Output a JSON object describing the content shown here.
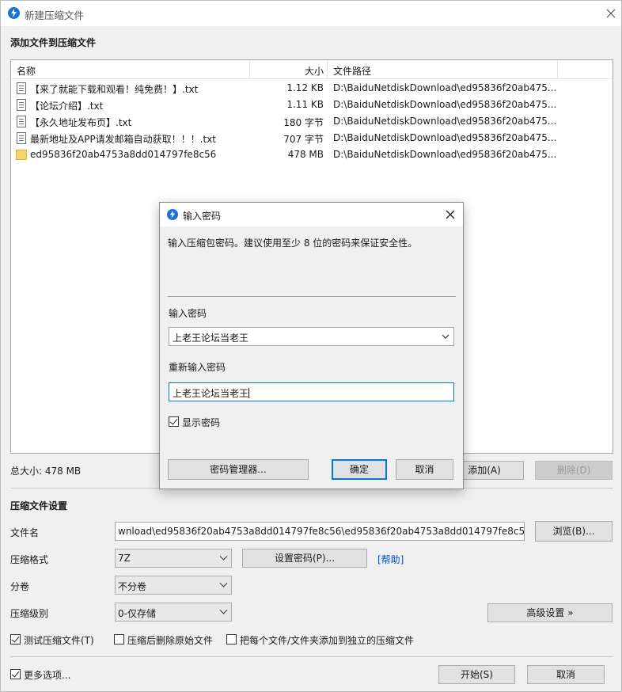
{
  "window": {
    "title": "新建压缩文件"
  },
  "add_section": {
    "title": "添加文件到压缩文件"
  },
  "file_list": {
    "columns": {
      "name": "名称",
      "size": "大小",
      "path": "文件路径"
    },
    "rows": [
      {
        "icon": "text-file-icon",
        "name": "【来了就能下载和观看！纯免费！】.txt",
        "size": "1.12 KB",
        "path": "D:\\BaiduNetdiskDownload\\ed95836f20ab475..."
      },
      {
        "icon": "text-file-icon",
        "name": "【论坛介绍】.txt",
        "size": "1.11 KB",
        "path": "D:\\BaiduNetdiskDownload\\ed95836f20ab475..."
      },
      {
        "icon": "text-file-icon",
        "name": "【永久地址发布页】.txt",
        "size": "180 字节",
        "path": "D:\\BaiduNetdiskDownload\\ed95836f20ab475..."
      },
      {
        "icon": "text-file-icon",
        "name": "最新地址及APP请发邮箱自动获取！！！.txt",
        "size": "707 字节",
        "path": "D:\\BaiduNetdiskDownload\\ed95836f20ab475..."
      },
      {
        "icon": "folder-icon",
        "name": "ed95836f20ab4753a8dd014797fe8c56",
        "size": "478 MB",
        "path": "D:\\BaiduNetdiskDownload\\ed95836f20ab475..."
      }
    ]
  },
  "total": {
    "label": "总大小: 478 MB"
  },
  "list_buttons": {
    "add": "添加(A)",
    "delete": "删除(D)"
  },
  "settings": {
    "title": "压缩文件设置",
    "filename_label": "文件名",
    "filename_value": "wnload\\ed95836f20ab4753a8dd014797fe8c56\\ed95836f20ab4753a8dd014797fe8c56.7z",
    "browse": "浏览(B)...",
    "format_label": "压缩格式",
    "format_value": "7Z",
    "set_password": "设置密码(P)...",
    "help": "[帮助]",
    "split_label": "分卷",
    "split_value": "不分卷",
    "level_label": "压缩级别",
    "level_value": "0-仅存储",
    "advanced": "高级设置 »"
  },
  "options": {
    "test": {
      "label": "测试压缩文件(T)",
      "checked": true
    },
    "delete_src": {
      "label": "压缩后删除原始文件",
      "checked": false
    },
    "each_separate": {
      "label": "把每个文件/文件夹添加到独立的压缩文件",
      "checked": false
    },
    "more": {
      "label": "更多选项...",
      "checked": true
    }
  },
  "footer": {
    "start": "开始(S)",
    "cancel": "取消"
  },
  "dialog": {
    "title": "输入密码",
    "message": "输入压缩包密码。建议使用至少 8 位的密码来保证安全性。",
    "password_label": "输入密码",
    "password_value": "上老王论坛当老王",
    "confirm_label": "重新输入密码",
    "confirm_value": "上老王论坛当老王",
    "show_password": {
      "label": "显示密码",
      "checked": true
    },
    "manager": "密码管理器...",
    "ok": "确定",
    "cancel": "取消"
  },
  "colors": {
    "accent": "#0078d7",
    "link": "#0050d0",
    "window_bg": "#f0f0f0"
  }
}
